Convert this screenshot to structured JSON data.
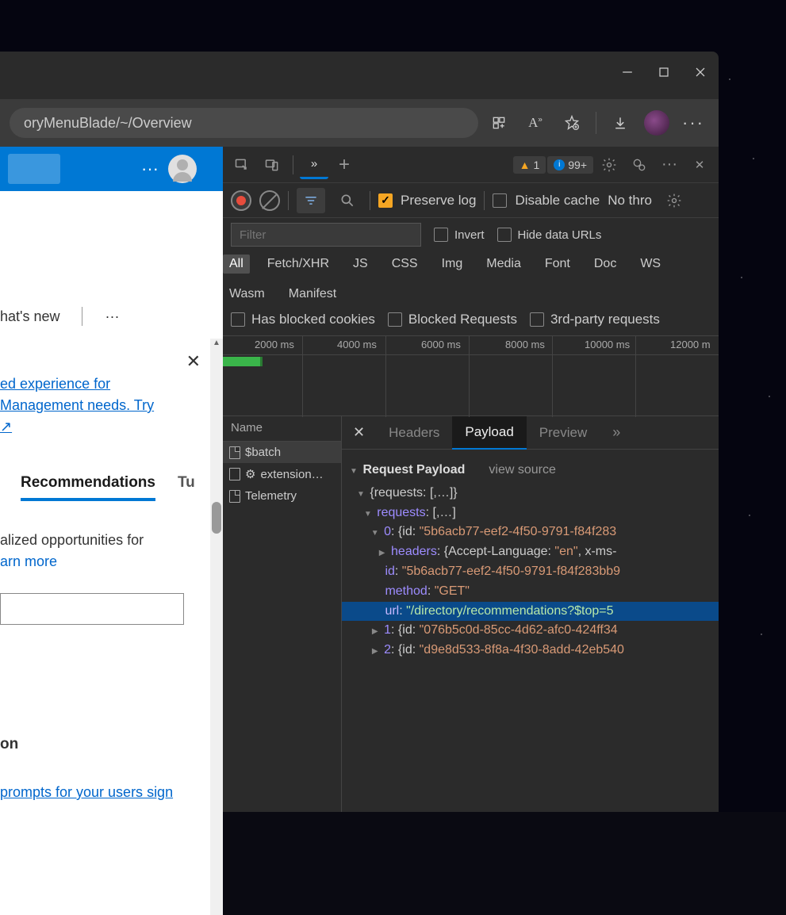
{
  "url_fragment": "oryMenuBlade/~/Overview",
  "window_controls": {
    "minimize": "–",
    "maximize": "□",
    "close": "✕"
  },
  "page": {
    "whats_new": "hat's new",
    "dots": "···",
    "close": "✕",
    "link_line1": "ed experience for",
    "link_line2": "Management needs. Try",
    "ext_icon": "↗",
    "tab_active": "Recommendations",
    "tab_other": "Tu",
    "body_text": "alized opportunities for",
    "learn_more": "arn more",
    "section": "on",
    "bottom_link": "prompts for your users sign"
  },
  "devtools": {
    "warn_count": "1",
    "info_count": "99+",
    "preserve_log": "Preserve log",
    "disable_cache": "Disable cache",
    "throttle": "No thro",
    "filter_placeholder": "Filter",
    "invert": "Invert",
    "hide_urls": "Hide data URLs",
    "types": [
      "All",
      "Fetch/XHR",
      "JS",
      "CSS",
      "Img",
      "Media",
      "Font",
      "Doc",
      "WS",
      "Wasm",
      "Manifest"
    ],
    "blocked_cookies": "Has blocked cookies",
    "blocked_requests": "Blocked Requests",
    "third_party": "3rd-party requests",
    "timeline_ticks": [
      "2000 ms",
      "4000 ms",
      "6000 ms",
      "8000 ms",
      "10000 ms",
      "12000 m"
    ],
    "name_header": "Name",
    "requests": [
      {
        "name": "$batch"
      },
      {
        "name": "extension…",
        "gear": true
      },
      {
        "name": "Telemetry"
      }
    ],
    "detail_tabs": [
      "Headers",
      "Payload",
      "Preview"
    ],
    "payload_title": "Request Payload",
    "view_source": "view source",
    "lines": {
      "l0": "{requests: [,…]}",
      "l1_key": "requests",
      "l1_tail": ": [,…]",
      "l2_key": "0",
      "l2_idstart": ": {id: ",
      "l2_idval": "\"5b6acb77-eef2-4f50-9791-f84f283",
      "l3_key": "headers",
      "l3_tail": ": {Accept-Language: ",
      "l3_lang": "\"en\"",
      "l3_tail2": ", x-ms-",
      "l4_key": "id",
      "l4_val": "\"5b6acb77-eef2-4f50-9791-f84f283bb9",
      "l5_key": "method",
      "l5_val": "\"GET\"",
      "l6_key": "url",
      "l6_val": "\"/directory/recommendations?$top=5",
      "l7_key": "1",
      "l7_tail": ": {id: ",
      "l7_val": "\"076b5c0d-85cc-4d62-afc0-424ff34",
      "l8_key": "2",
      "l8_tail": ": {id: ",
      "l8_val": "\"d9e8d533-8f8a-4f30-8add-42eb540"
    }
  }
}
